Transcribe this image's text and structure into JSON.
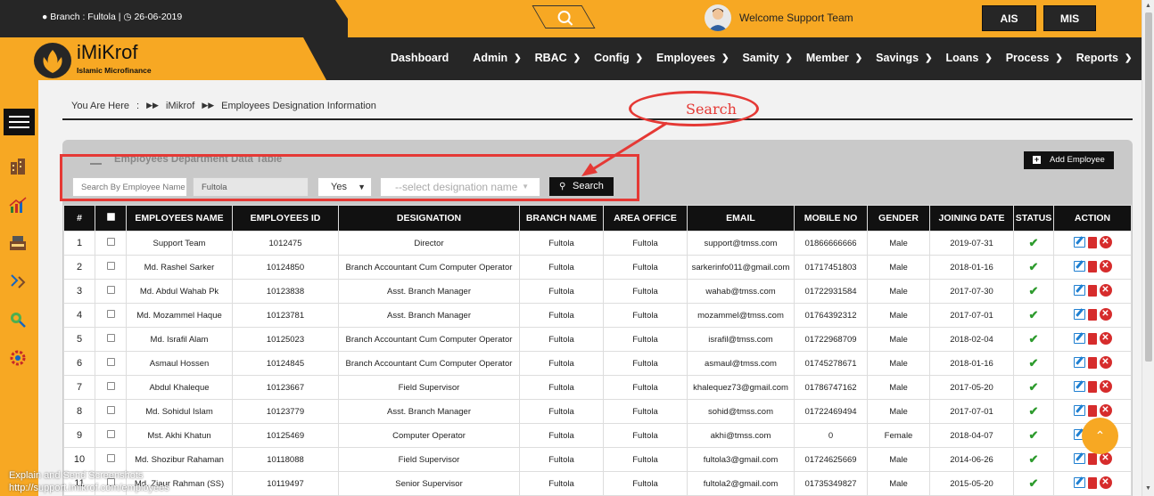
{
  "topbar": {
    "branch_info": "Branch : Fultola |",
    "date": "26-06-2019",
    "welcome": "Welcome Support Team",
    "btn_ais": "AIS",
    "btn_mis": "MIS"
  },
  "logo": {
    "title": "iMiKrof",
    "subtitle": "Islamic Microfinance"
  },
  "nav": [
    {
      "label": "Dashboard",
      "chev": false
    },
    {
      "label": "Admin",
      "chev": true
    },
    {
      "label": "RBAC",
      "chev": true
    },
    {
      "label": "Config",
      "chev": true
    },
    {
      "label": "Employees",
      "chev": true
    },
    {
      "label": "Samity",
      "chev": true
    },
    {
      "label": "Member",
      "chev": true
    },
    {
      "label": "Savings",
      "chev": true
    },
    {
      "label": "Loans",
      "chev": true
    },
    {
      "label": "Process",
      "chev": true
    },
    {
      "label": "Reports",
      "chev": true
    }
  ],
  "breadcrumb": {
    "you_are_here": "You Are Here",
    "sep": ":",
    "root": "iMikrof",
    "current": "Employees Designation Information"
  },
  "panel": {
    "title": "Employees Department Data Table",
    "add_label": "Add Employee"
  },
  "filters": {
    "employee_placeholder": "Search By Employee Name",
    "branch_value": "Fultola",
    "yes_value": "Yes",
    "designation_placeholder": "--select designation name",
    "search_label": "Search"
  },
  "annotation": {
    "label": "Search"
  },
  "table": {
    "headers": [
      "#",
      "",
      "EMPLOYEES NAME",
      "EMPLOYEES ID",
      "DESIGNATION",
      "BRANCH NAME",
      "AREA OFFICE",
      "EMAIL",
      "MOBILE NO",
      "GENDER",
      "JOINING DATE",
      "STATUS",
      "ACTION"
    ],
    "rows": [
      {
        "n": "1",
        "name": "Support Team",
        "id": "1012475",
        "designation": "Director",
        "branch": "Fultola",
        "area": "Fultola",
        "email": "support@tmss.com",
        "mobile": "01866666666",
        "gender": "Male",
        "joined": "2019-07-31"
      },
      {
        "n": "2",
        "name": "Md. Rashel Sarker",
        "id": "10124850",
        "designation": "Branch Accountant Cum Computer Operator",
        "branch": "Fultola",
        "area": "Fultola",
        "email": "sarkerinfo011@gmail.com",
        "mobile": "01717451803",
        "gender": "Male",
        "joined": "2018-01-16"
      },
      {
        "n": "3",
        "name": "Md. Abdul Wahab Pk",
        "id": "10123838",
        "designation": "Asst. Branch Manager",
        "branch": "Fultola",
        "area": "Fultola",
        "email": "wahab@tmss.com",
        "mobile": "01722931584",
        "gender": "Male",
        "joined": "2017-07-30"
      },
      {
        "n": "4",
        "name": "Md. Mozammel Haque",
        "id": "10123781",
        "designation": "Asst. Branch Manager",
        "branch": "Fultola",
        "area": "Fultola",
        "email": "mozammel@tmss.com",
        "mobile": "01764392312",
        "gender": "Male",
        "joined": "2017-07-01"
      },
      {
        "n": "5",
        "name": "Md. Israfil Alam",
        "id": "10125023",
        "designation": "Branch Accountant Cum Computer Operator",
        "branch": "Fultola",
        "area": "Fultola",
        "email": "israfil@tmss.com",
        "mobile": "01722968709",
        "gender": "Male",
        "joined": "2018-02-04"
      },
      {
        "n": "6",
        "name": "Asmaul Hossen",
        "id": "10124845",
        "designation": "Branch Accountant Cum Computer Operator",
        "branch": "Fultola",
        "area": "Fultola",
        "email": "asmaul@tmss.com",
        "mobile": "01745278671",
        "gender": "Male",
        "joined": "2018-01-16"
      },
      {
        "n": "7",
        "name": "Abdul Khaleque",
        "id": "10123667",
        "designation": "Field Supervisor",
        "branch": "Fultola",
        "area": "Fultola",
        "email": "khalequez73@gmail.com",
        "mobile": "01786747162",
        "gender": "Male",
        "joined": "2017-05-20"
      },
      {
        "n": "8",
        "name": "Md. Sohidul Islam",
        "id": "10123779",
        "designation": "Asst. Branch Manager",
        "branch": "Fultola",
        "area": "Fultola",
        "email": "sohid@tmss.com",
        "mobile": "01722469494",
        "gender": "Male",
        "joined": "2017-07-01"
      },
      {
        "n": "9",
        "name": "Mst. Akhi Khatun",
        "id": "10125469",
        "designation": "Computer Operator",
        "branch": "Fultola",
        "area": "Fultola",
        "email": "akhi@tmss.com",
        "mobile": "0",
        "gender": "Female",
        "joined": "2018-04-07"
      },
      {
        "n": "10",
        "name": "Md. Shozibur Rahaman",
        "id": "10118088",
        "designation": "Field Supervisor",
        "branch": "Fultola",
        "area": "Fultola",
        "email": "fultola3@gmail.com",
        "mobile": "01724625669",
        "gender": "Male",
        "joined": "2014-06-26"
      },
      {
        "n": "11",
        "name": "Md. Ziaur Rahman (SS)",
        "id": "10119497",
        "designation": "Senior Supervisor",
        "branch": "Fultola",
        "area": "Fultola",
        "email": "fultola2@gmail.com",
        "mobile": "01735349827",
        "gender": "Male",
        "joined": "2015-05-20"
      }
    ]
  },
  "overlay_status": {
    "line1": "Explain and Send Screenshots",
    "line2": "http://support.imikrof.com/employees"
  },
  "colors": {
    "accent": "#f7a823",
    "dark": "#262626",
    "annotation": "#e53935",
    "status_ok": "#2e9b2e"
  }
}
